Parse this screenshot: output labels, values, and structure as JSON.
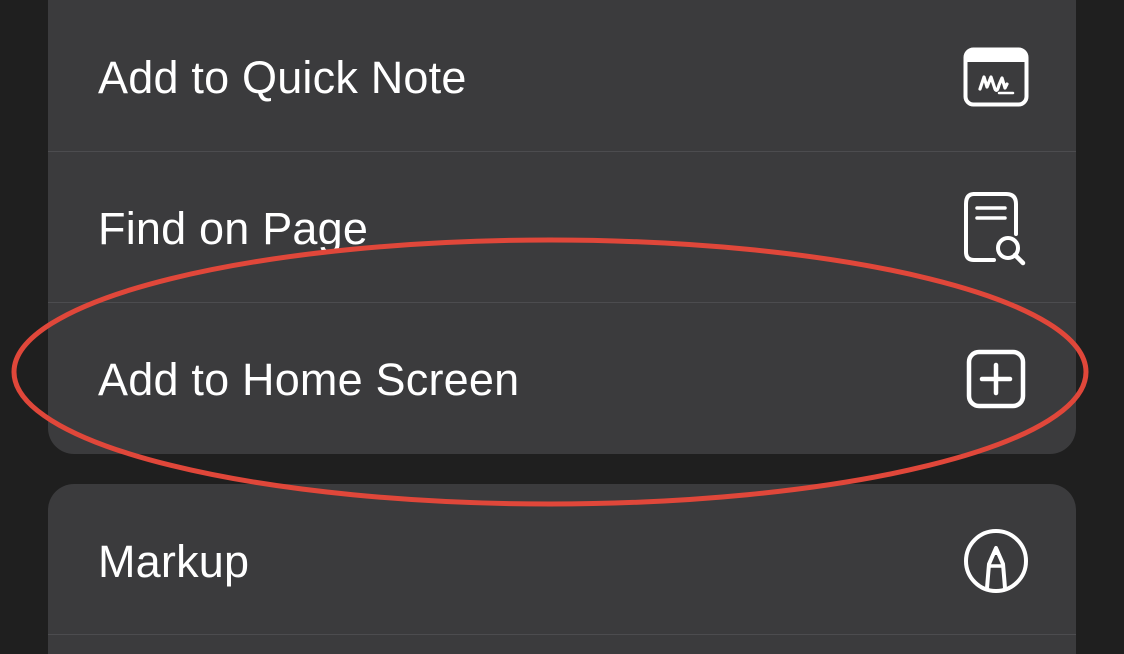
{
  "menu": {
    "group1": [
      {
        "label": "Add to Quick Note",
        "icon": "quick-note-icon"
      },
      {
        "label": "Find on Page",
        "icon": "find-on-page-icon"
      },
      {
        "label": "Add to Home Screen",
        "icon": "add-square-icon"
      }
    ],
    "group2": [
      {
        "label": "Markup",
        "icon": "markup-pen-icon"
      }
    ]
  },
  "annotation": {
    "type": "ellipse-highlight",
    "target": "Add to Home Screen",
    "color": "#e0473a"
  },
  "colors": {
    "background": "#1f1f1f",
    "cell": "#3b3b3d",
    "separator": "#4c4c4f",
    "text": "#ffffff"
  }
}
